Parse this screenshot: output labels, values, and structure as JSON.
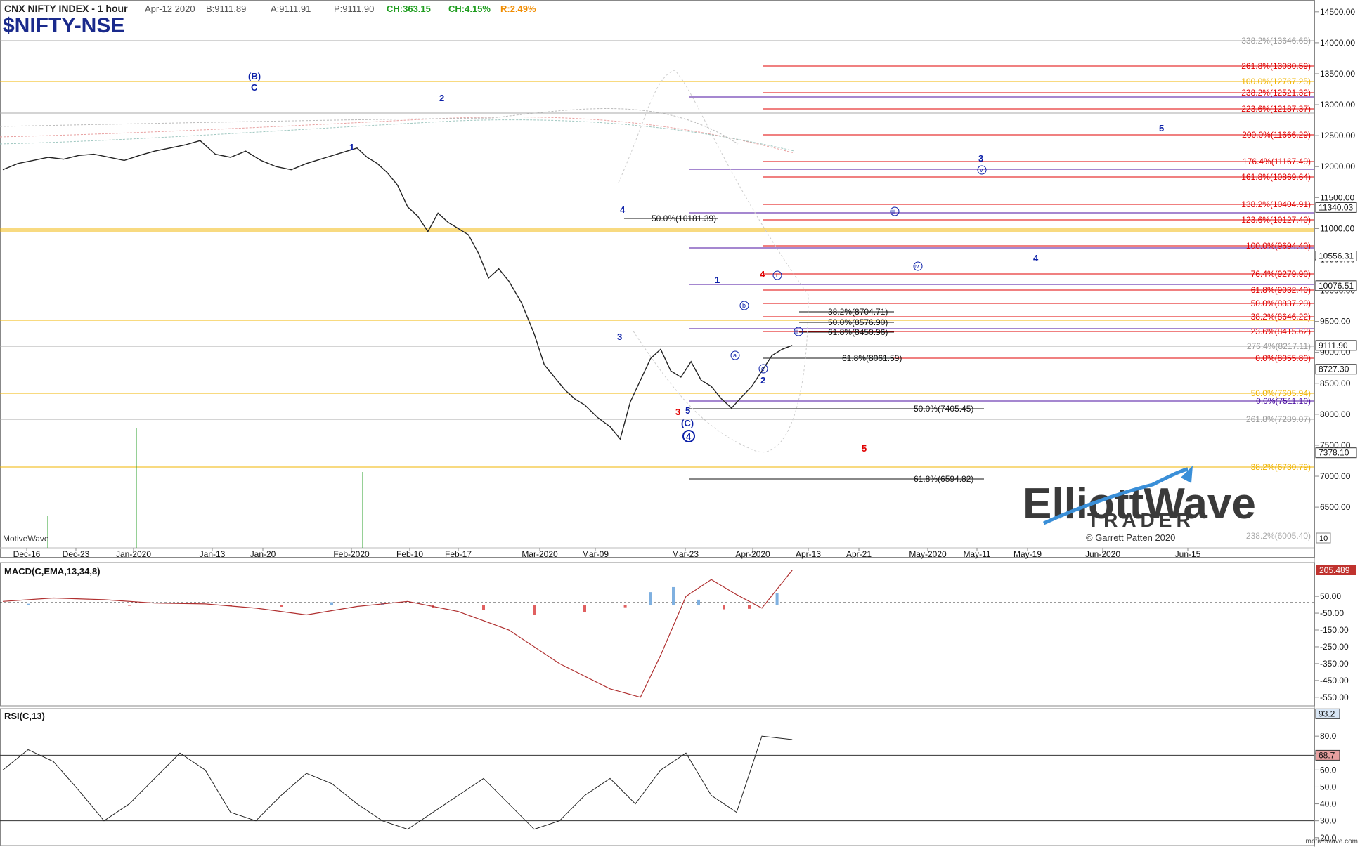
{
  "header": {
    "index_name": "CNX NIFTY INDEX - 1 hour",
    "date": "Apr-12 2020",
    "bid": "B:9111.89",
    "ask": "A:9111.91",
    "price": "P:9111.90",
    "change_points": "CH:363.15",
    "change_pct": "CH:4.15%",
    "range": "R:2.49%",
    "symbol": "$NIFTY-NSE"
  },
  "colors": {
    "red": "#e00000",
    "purple": "#4b0fa0",
    "orange": "#f0b400",
    "gray": "#a0a0a0",
    "blue": "#0b1fa8",
    "green": "#2ca02c",
    "price_up": "#1f9d1f"
  },
  "chart_data": [
    {
      "type": "line",
      "name": "price",
      "x_ticks": [
        "Dec-16",
        "Dec-23",
        "Jan-2020",
        "Jan-13",
        "Jan-20",
        "Feb-2020",
        "Feb-10",
        "Feb-17",
        "Mar-2020",
        "Mar-09",
        "Mar-23",
        "Apr-2020",
        "Apr-13",
        "Apr-21",
        "May-2020",
        "May-11",
        "May-19",
        "Jun-2020",
        "Jun-15"
      ],
      "y_ticks": [
        14500,
        14000,
        13500,
        13000,
        12500,
        12000,
        11500,
        11000,
        10500,
        10000,
        9500,
        9000,
        8500,
        8000,
        7500,
        7000,
        6500
      ],
      "ylim": [
        5900,
        14600
      ],
      "price_tags": [
        {
          "label": "11340.03",
          "value": 11340.03
        },
        {
          "label": "10556.31",
          "value": 10556.31
        },
        {
          "label": "10076.51",
          "value": 10076.51
        },
        {
          "label": "9111.90",
          "value": 9111.9
        },
        {
          "label": "8727.30",
          "value": 8727.3
        },
        {
          "label": "7378.10",
          "value": 7378.1
        }
      ],
      "series": [
        {
          "x": [
            0,
            6,
            12,
            18,
            24,
            30,
            36,
            42,
            48,
            54,
            60,
            66,
            72,
            78,
            84,
            90,
            96,
            102,
            108,
            114,
            120,
            124,
            128,
            132,
            136,
            140,
            144,
            148,
            152,
            156,
            160,
            164,
            168,
            172,
            176,
            180,
            184,
            188,
            192,
            196,
            200,
            205,
            210,
            214,
            218,
            222,
            226,
            230,
            235,
            240,
            244,
            248,
            252,
            256,
            260,
            264,
            268,
            272,
            276,
            280,
            284,
            288,
            292,
            296,
            300,
            304,
            308,
            312
          ],
          "y": [
            11950,
            12050,
            12100,
            12150,
            12120,
            12180,
            12200,
            12150,
            12100,
            12180,
            12250,
            12300,
            12350,
            12420,
            12200,
            12150,
            12250,
            12100,
            12000,
            11950,
            12050,
            12100,
            12150,
            12200,
            12250,
            12300,
            12150,
            12050,
            11900,
            11700,
            11350,
            11200,
            10950,
            11250,
            11100,
            11000,
            10900,
            10600,
            10200,
            10350,
            10150,
            9800,
            9300,
            8800,
            8600,
            8400,
            8250,
            8150,
            7950,
            7800,
            7600,
            8200,
            8550,
            8900,
            9050,
            8700,
            8600,
            8850,
            8550,
            8450,
            8250,
            8100,
            8280,
            8450,
            8700,
            8950,
            9050,
            9111.9
          ]
        }
      ]
    },
    {
      "type": "line",
      "name": "MACD(C,EMA,13,34,8)",
      "y_ticks": [
        50,
        -50,
        -150,
        -250,
        -350,
        -450,
        -550
      ],
      "ylim": [
        -580,
        230
      ],
      "current_value": "205.489",
      "series": [
        {
          "x": [
            0,
            20,
            40,
            60,
            80,
            100,
            120,
            140,
            160,
            180,
            200,
            220,
            240,
            252,
            260,
            270,
            280,
            290,
            300,
            312
          ],
          "y": [
            20,
            40,
            30,
            10,
            5,
            -20,
            -60,
            -10,
            20,
            -40,
            -150,
            -350,
            -500,
            -550,
            -300,
            50,
            150,
            60,
            -20,
            205.489
          ]
        }
      ]
    },
    {
      "type": "line",
      "name": "RSI(C,13)",
      "y_ticks": [
        80,
        70,
        60,
        50,
        40,
        30,
        20
      ],
      "ylim": [
        17,
        95
      ],
      "levels": {
        "upper": 93.2,
        "mid": 68.7
      },
      "series": [
        {
          "x": [
            0,
            10,
            20,
            30,
            40,
            50,
            60,
            70,
            80,
            90,
            100,
            110,
            120,
            130,
            140,
            150,
            160,
            170,
            180,
            190,
            200,
            210,
            220,
            230,
            240,
            250,
            260,
            270,
            280,
            290,
            300,
            312
          ],
          "y": [
            60,
            72,
            65,
            48,
            30,
            40,
            55,
            70,
            60,
            35,
            30,
            45,
            58,
            52,
            40,
            30,
            25,
            35,
            45,
            55,
            40,
            25,
            30,
            45,
            55,
            40,
            60,
            70,
            45,
            35,
            80,
            78
          ]
        }
      ]
    }
  ],
  "fib_labels": {
    "top": "338.2%(13646.68)",
    "r1": "261.8%(13080.59)",
    "r2": "100.0%(12767.25)",
    "r3": "238.2%(12521.32)",
    "r4": "223.6%(12187.37)",
    "r5": "200.0%(11666.29)",
    "r6": "176.4%(11167.49)",
    "r7": "161.8%(10869.64)",
    "r8": "138.2%(10404.91)",
    "r9": "123.6%(10127.40)",
    "r10": "100.0%(9694.40)",
    "r11": "76.4%(9279.90)",
    "r12": "61.8%(9032.40)",
    "r13": "50.0%(8837.20)",
    "r14": "38.2%(8646.22)",
    "r15": "23.6%(8415.62)",
    "r16": "276.4%(8217.11)",
    "r17": "0.0%(8055.80)",
    "r18": "50.0%(7605.94)",
    "r19": "0.0%(7511.10)",
    "r20": "261.8%(7289.07)",
    "r21": "38.2%(6730.79)",
    "bottom": "238.2%(6005.40)",
    "m1": "50.0%(10181.39)",
    "m2": "38.2%(8704.71)",
    "m3": "50.0%(8576.90)",
    "m4": "61.8%(8450.96)",
    "m5": "61.8%(8061.59)",
    "m6": "50.0%(7405.45)",
    "m7": "61.8%(6594.82)"
  },
  "wave_labels": {
    "b_paren": "(B)",
    "c_top": "C",
    "w1a": "1",
    "w2a": "2",
    "w3a": "3",
    "w4a": "4",
    "w5a": "5",
    "c_paren": "(C)",
    "circle4": "4",
    "red3": "3",
    "red4": "4",
    "red5": "5",
    "w1b": "1",
    "w2b": "2",
    "small_a": "a",
    "small_b": "b",
    "small_c": "c",
    "roman_i": "i",
    "roman_ii": "ii",
    "roman_iii": "iii",
    "roman_iv": "iv",
    "roman_v": "v",
    "f3": "3",
    "f4": "4",
    "f5": "5"
  },
  "footer": {
    "watermark_left": "MotiveWave",
    "brand_top": "ElliottWave",
    "brand_bottom": "TRADER",
    "copyright": "© Garrett Patten 2020",
    "site": "motivewave.com",
    "axis_box": "10"
  }
}
